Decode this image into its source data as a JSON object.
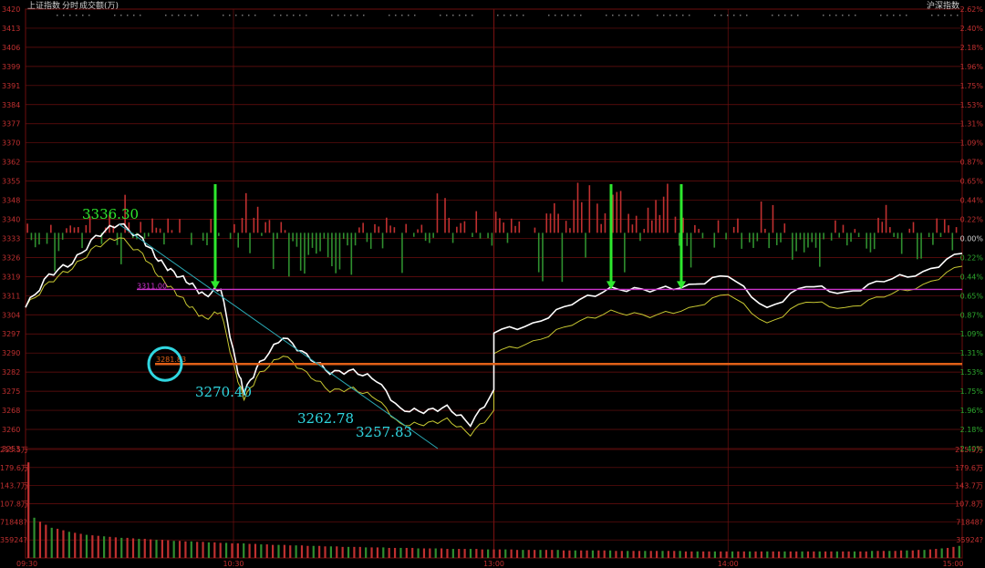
{
  "header": {
    "index_name": "上证指数",
    "mode": "分时",
    "volume_label": "成交额(万)",
    "right_label": "沪深指数"
  },
  "colors": {
    "background": "#000000",
    "grid": "#6e0f0f",
    "price_line": "#ffffff",
    "avg_line": "#c8c832",
    "up_bar": "#c03030",
    "down_bar": "#2f8f2f",
    "axis_text_left": "#c03030",
    "axis_text_right": "#c03030",
    "annotation_green": "#2ee82e",
    "annotation_cyan": "#30d6e0",
    "support_line": "#cc33cc",
    "resistance_line": "#e06018",
    "trend_line": "#2aa9b4"
  },
  "chart_data": {
    "type": "line",
    "price_axis_labels_left": [
      "3420",
      "3413",
      "3406",
      "3399",
      "3391",
      "3384",
      "3377",
      "3370",
      "3362",
      "3355",
      "3348",
      "3340",
      "3333",
      "3326",
      "3319",
      "3311",
      "3304",
      "3297",
      "3290",
      "3282",
      "3275",
      "3268",
      "3260",
      "3253"
    ],
    "pct_axis_labels_right": [
      "2.62%",
      "2.40%",
      "2.18%",
      "1.96%",
      "1.75%",
      "1.53%",
      "1.31%",
      "1.09%",
      "0.87%",
      "0.65%",
      "0.44%",
      "0.22%",
      "0.00%",
      "0.22%",
      "0.44%",
      "0.65%",
      "0.87%",
      "1.09%",
      "1.31%",
      "1.53%",
      "1.75%",
      "1.96%",
      "2.18%",
      "2.40%"
    ],
    "volume_axis_labels_left": [
      "215.5万",
      "179.6万",
      "143.7万",
      "107.8万",
      "71848?",
      "35924?"
    ],
    "volume_axis_labels_right": [
      "215.5万",
      "179.6万",
      "143.7万",
      "107.8万",
      "71848?",
      "35924?"
    ],
    "time_labels": [
      "09:30",
      "10:30",
      "13:00",
      "14:00",
      "15:00"
    ],
    "prev_close": 3333,
    "ylim": [
      3253,
      3420
    ],
    "series": [
      {
        "name": "price",
        "points": [
          [
            "09:30",
            3304
          ],
          [
            "09:36",
            3317
          ],
          [
            "09:42",
            3321
          ],
          [
            "09:48",
            3332
          ],
          [
            "09:54",
            3336.3
          ],
          [
            "10:00",
            3331
          ],
          [
            "10:04",
            3322
          ],
          [
            "10:08",
            3318
          ],
          [
            "10:12",
            3313
          ],
          [
            "10:16",
            3309
          ],
          [
            "10:20",
            3311
          ],
          [
            "10:24",
            3282
          ],
          [
            "10:26",
            3270.4
          ],
          [
            "10:30",
            3283
          ],
          [
            "10:36",
            3292
          ],
          [
            "10:42",
            3286
          ],
          [
            "10:48",
            3278
          ],
          [
            "10:54",
            3280
          ],
          [
            "11:00",
            3275
          ],
          [
            "11:06",
            3265
          ],
          [
            "11:12",
            3262.78
          ],
          [
            "11:18",
            3266
          ],
          [
            "11:24",
            3257.83
          ],
          [
            "11:30",
            3272
          ],
          [
            "13:00",
            3294
          ],
          [
            "13:10",
            3298
          ],
          [
            "13:20",
            3305
          ],
          [
            "13:30",
            3312
          ],
          [
            "13:40",
            3310
          ],
          [
            "13:50",
            3313
          ],
          [
            "14:00",
            3316
          ],
          [
            "14:10",
            3304
          ],
          [
            "14:20",
            3312
          ],
          [
            "14:30",
            3310
          ],
          [
            "14:40",
            3314
          ],
          [
            "14:50",
            3318
          ],
          [
            "15:00",
            3325
          ]
        ]
      },
      {
        "name": "avg",
        "points": [
          [
            "09:30",
            3304
          ],
          [
            "09:36",
            3314
          ],
          [
            "09:42",
            3319
          ],
          [
            "09:48",
            3328
          ],
          [
            "09:54",
            3331
          ],
          [
            "10:00",
            3325
          ],
          [
            "10:04",
            3316
          ],
          [
            "10:08",
            3311
          ],
          [
            "10:12",
            3304
          ],
          [
            "10:16",
            3300
          ],
          [
            "10:20",
            3302
          ],
          [
            "10:24",
            3278
          ],
          [
            "10:26",
            3268
          ],
          [
            "10:30",
            3279
          ],
          [
            "10:36",
            3285
          ],
          [
            "10:42",
            3279
          ],
          [
            "10:48",
            3271
          ],
          [
            "10:54",
            3273
          ],
          [
            "11:00",
            3268
          ],
          [
            "11:06",
            3259
          ],
          [
            "11:12",
            3258
          ],
          [
            "11:18",
            3261
          ],
          [
            "11:24",
            3254
          ],
          [
            "11:30",
            3264
          ],
          [
            "13:00",
            3286
          ],
          [
            "13:10",
            3291
          ],
          [
            "13:20",
            3297
          ],
          [
            "13:30",
            3303
          ],
          [
            "13:40",
            3300
          ],
          [
            "13:50",
            3304
          ],
          [
            "14:00",
            3309
          ],
          [
            "14:10",
            3298
          ],
          [
            "14:20",
            3306
          ],
          [
            "14:30",
            3304
          ],
          [
            "14:40",
            3308
          ],
          [
            "14:50",
            3313
          ],
          [
            "15:00",
            3320
          ]
        ]
      }
    ],
    "volume": {
      "values": [
        190,
        80,
        72,
        66,
        60,
        58,
        55,
        52,
        50,
        48,
        46,
        45,
        44,
        43,
        42,
        41,
        40,
        40,
        39,
        38,
        38,
        37,
        36,
        36,
        35,
        34,
        34,
        33,
        33,
        32,
        32,
        31,
        31,
        30,
        30,
        29,
        29,
        29,
        28,
        28,
        27,
        27,
        26,
        26,
        26,
        25,
        25,
        25,
        24,
        24,
        24,
        23,
        23,
        23,
        22,
        22,
        22,
        22,
        21,
        21,
        21,
        21,
        20,
        20,
        20,
        20,
        20,
        19,
        19,
        19,
        19,
        19,
        18,
        18,
        18,
        18,
        18,
        18,
        17,
        17,
        17,
        17,
        17,
        17,
        16,
        16,
        16,
        16,
        16,
        16,
        16,
        16,
        15,
        15,
        15,
        15,
        15,
        15,
        15,
        15,
        15,
        14,
        14,
        14,
        14,
        14,
        14,
        14,
        14,
        14,
        14,
        14,
        14,
        13,
        13,
        13,
        13,
        13,
        13,
        13,
        13,
        13,
        13,
        13,
        13,
        13,
        13,
        13,
        13,
        13,
        13,
        13,
        13,
        13,
        13,
        13,
        13,
        13,
        13,
        13,
        13,
        13,
        13,
        13,
        13,
        14,
        14,
        14,
        14,
        14,
        15,
        15,
        15,
        16,
        16,
        17,
        18,
        19,
        20,
        22,
        24
      ]
    },
    "annotations": {
      "high": "3336.30",
      "low1": "3270.40",
      "low2": "3262.78",
      "low3": "3257.83",
      "support_value": 3311,
      "resistance_value": 3282,
      "circle_label": "3281.83",
      "support_label": "3311.00"
    }
  }
}
